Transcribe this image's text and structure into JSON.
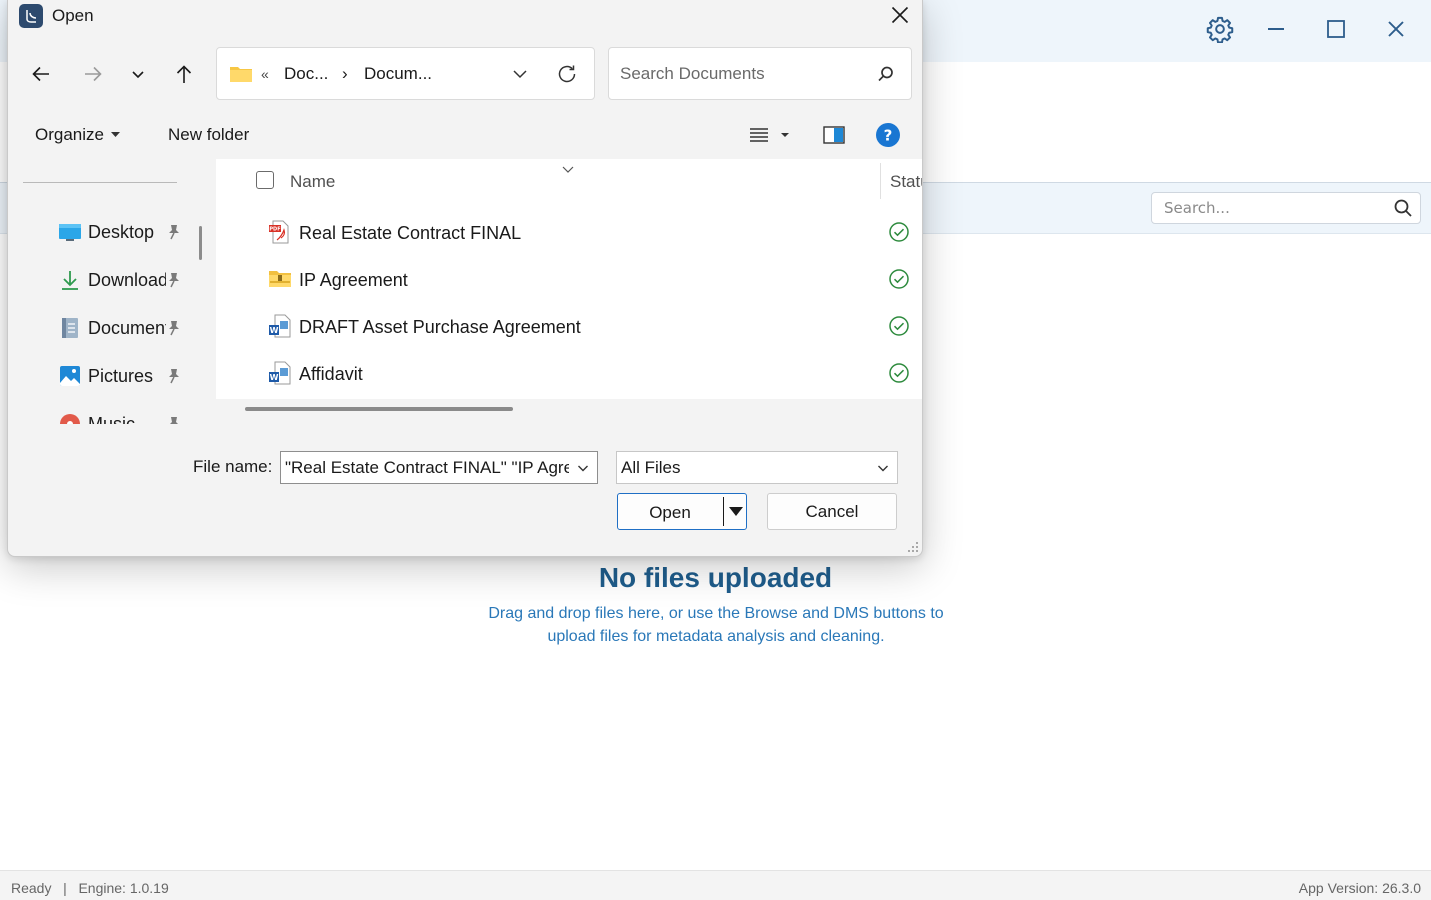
{
  "app": {
    "search": {
      "placeholder": "Search..."
    },
    "empty_state": {
      "title": "No files uploaded",
      "subtitle": "Drag and drop files here, or use the Browse and DMS buttons to upload files for metadata analysis and cleaning."
    },
    "status": {
      "left": "Ready   |   Engine: 1.0.19",
      "right": "App Version: 26.3.0"
    }
  },
  "dialog": {
    "title": "Open",
    "address": {
      "chevrons": "«",
      "crumb1": "Doc...",
      "separator": "›",
      "crumb2": "Docum..."
    },
    "search_placeholder": "Search Documents",
    "commands": {
      "organize": "Organize",
      "new_folder": "New folder"
    },
    "nav_items": [
      {
        "label": "Desktop",
        "icon": "desktop-icon"
      },
      {
        "label": "Downloads",
        "icon": "download-icon"
      },
      {
        "label": "Documents",
        "icon": "documents-icon"
      },
      {
        "label": "Pictures",
        "icon": "pictures-icon"
      },
      {
        "label": "Music",
        "icon": "music-icon"
      }
    ],
    "columns": {
      "name": "Name",
      "status": "Status"
    },
    "files": [
      {
        "name": "Real Estate Contract FINAL",
        "type": "pdf"
      },
      {
        "name": "IP Agreement",
        "type": "folder"
      },
      {
        "name": "DRAFT Asset Purchase Agreement",
        "type": "word"
      },
      {
        "name": "Affidavit",
        "type": "word"
      }
    ],
    "file_name_label": "File name:",
    "file_name_value": "\"Real Estate Contract FINAL\" \"IP Agreement\"",
    "file_type": "All Files",
    "open_label": "Open",
    "cancel_label": "Cancel"
  },
  "colors": {
    "accent": "#1f6fc5",
    "empty_title": "#1f5d8c",
    "empty_subtitle": "#2a78b8",
    "sync_ok": "#2e8b3e"
  }
}
